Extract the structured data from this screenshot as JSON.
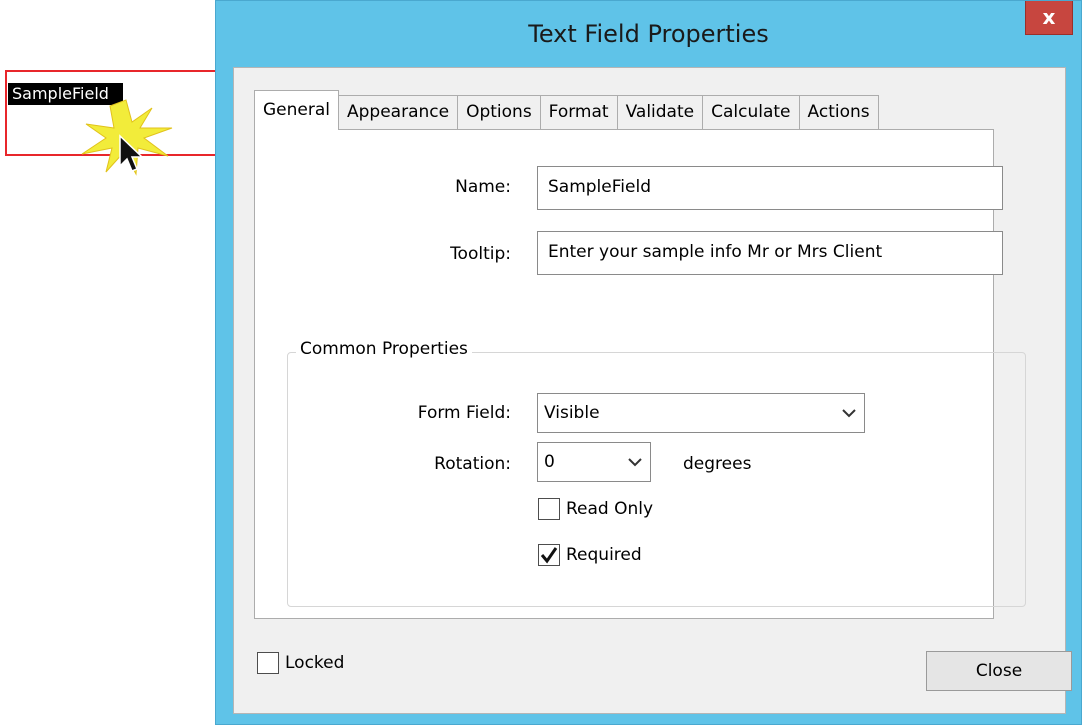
{
  "document": {
    "field_tag": "SampleField"
  },
  "dialog": {
    "title": "Text Field Properties",
    "close_glyph": "x",
    "tabs": [
      {
        "label": "General",
        "active": true
      },
      {
        "label": "Appearance",
        "active": false
      },
      {
        "label": "Options",
        "active": false
      },
      {
        "label": "Format",
        "active": false
      },
      {
        "label": "Validate",
        "active": false
      },
      {
        "label": "Calculate",
        "active": false
      },
      {
        "label": "Actions",
        "active": false
      }
    ],
    "general": {
      "name_label": "Name:",
      "name_value": "SampleField",
      "tooltip_label": "Tooltip:",
      "tooltip_value": "Enter your sample info Mr or Mrs Client",
      "common_properties": {
        "legend": "Common Properties",
        "form_field_label": "Form Field:",
        "form_field_value": "Visible",
        "rotation_label": "Rotation:",
        "rotation_value": "0",
        "rotation_unit": "degrees",
        "read_only_label": "Read Only",
        "read_only_checked": false,
        "required_label": "Required",
        "required_checked": true
      }
    },
    "locked_label": "Locked",
    "locked_checked": false,
    "close_button": "Close"
  },
  "colors": {
    "title_bar": "#5fc3e8",
    "close_x": "#c7463f",
    "field_border": "#e8262b",
    "burst": "#f2ec3a"
  },
  "icons": {
    "burst": "click-burst-icon",
    "cursor": "arrow-cursor-icon",
    "dropdown": "chevron-down-icon",
    "check": "checkmark-icon"
  }
}
